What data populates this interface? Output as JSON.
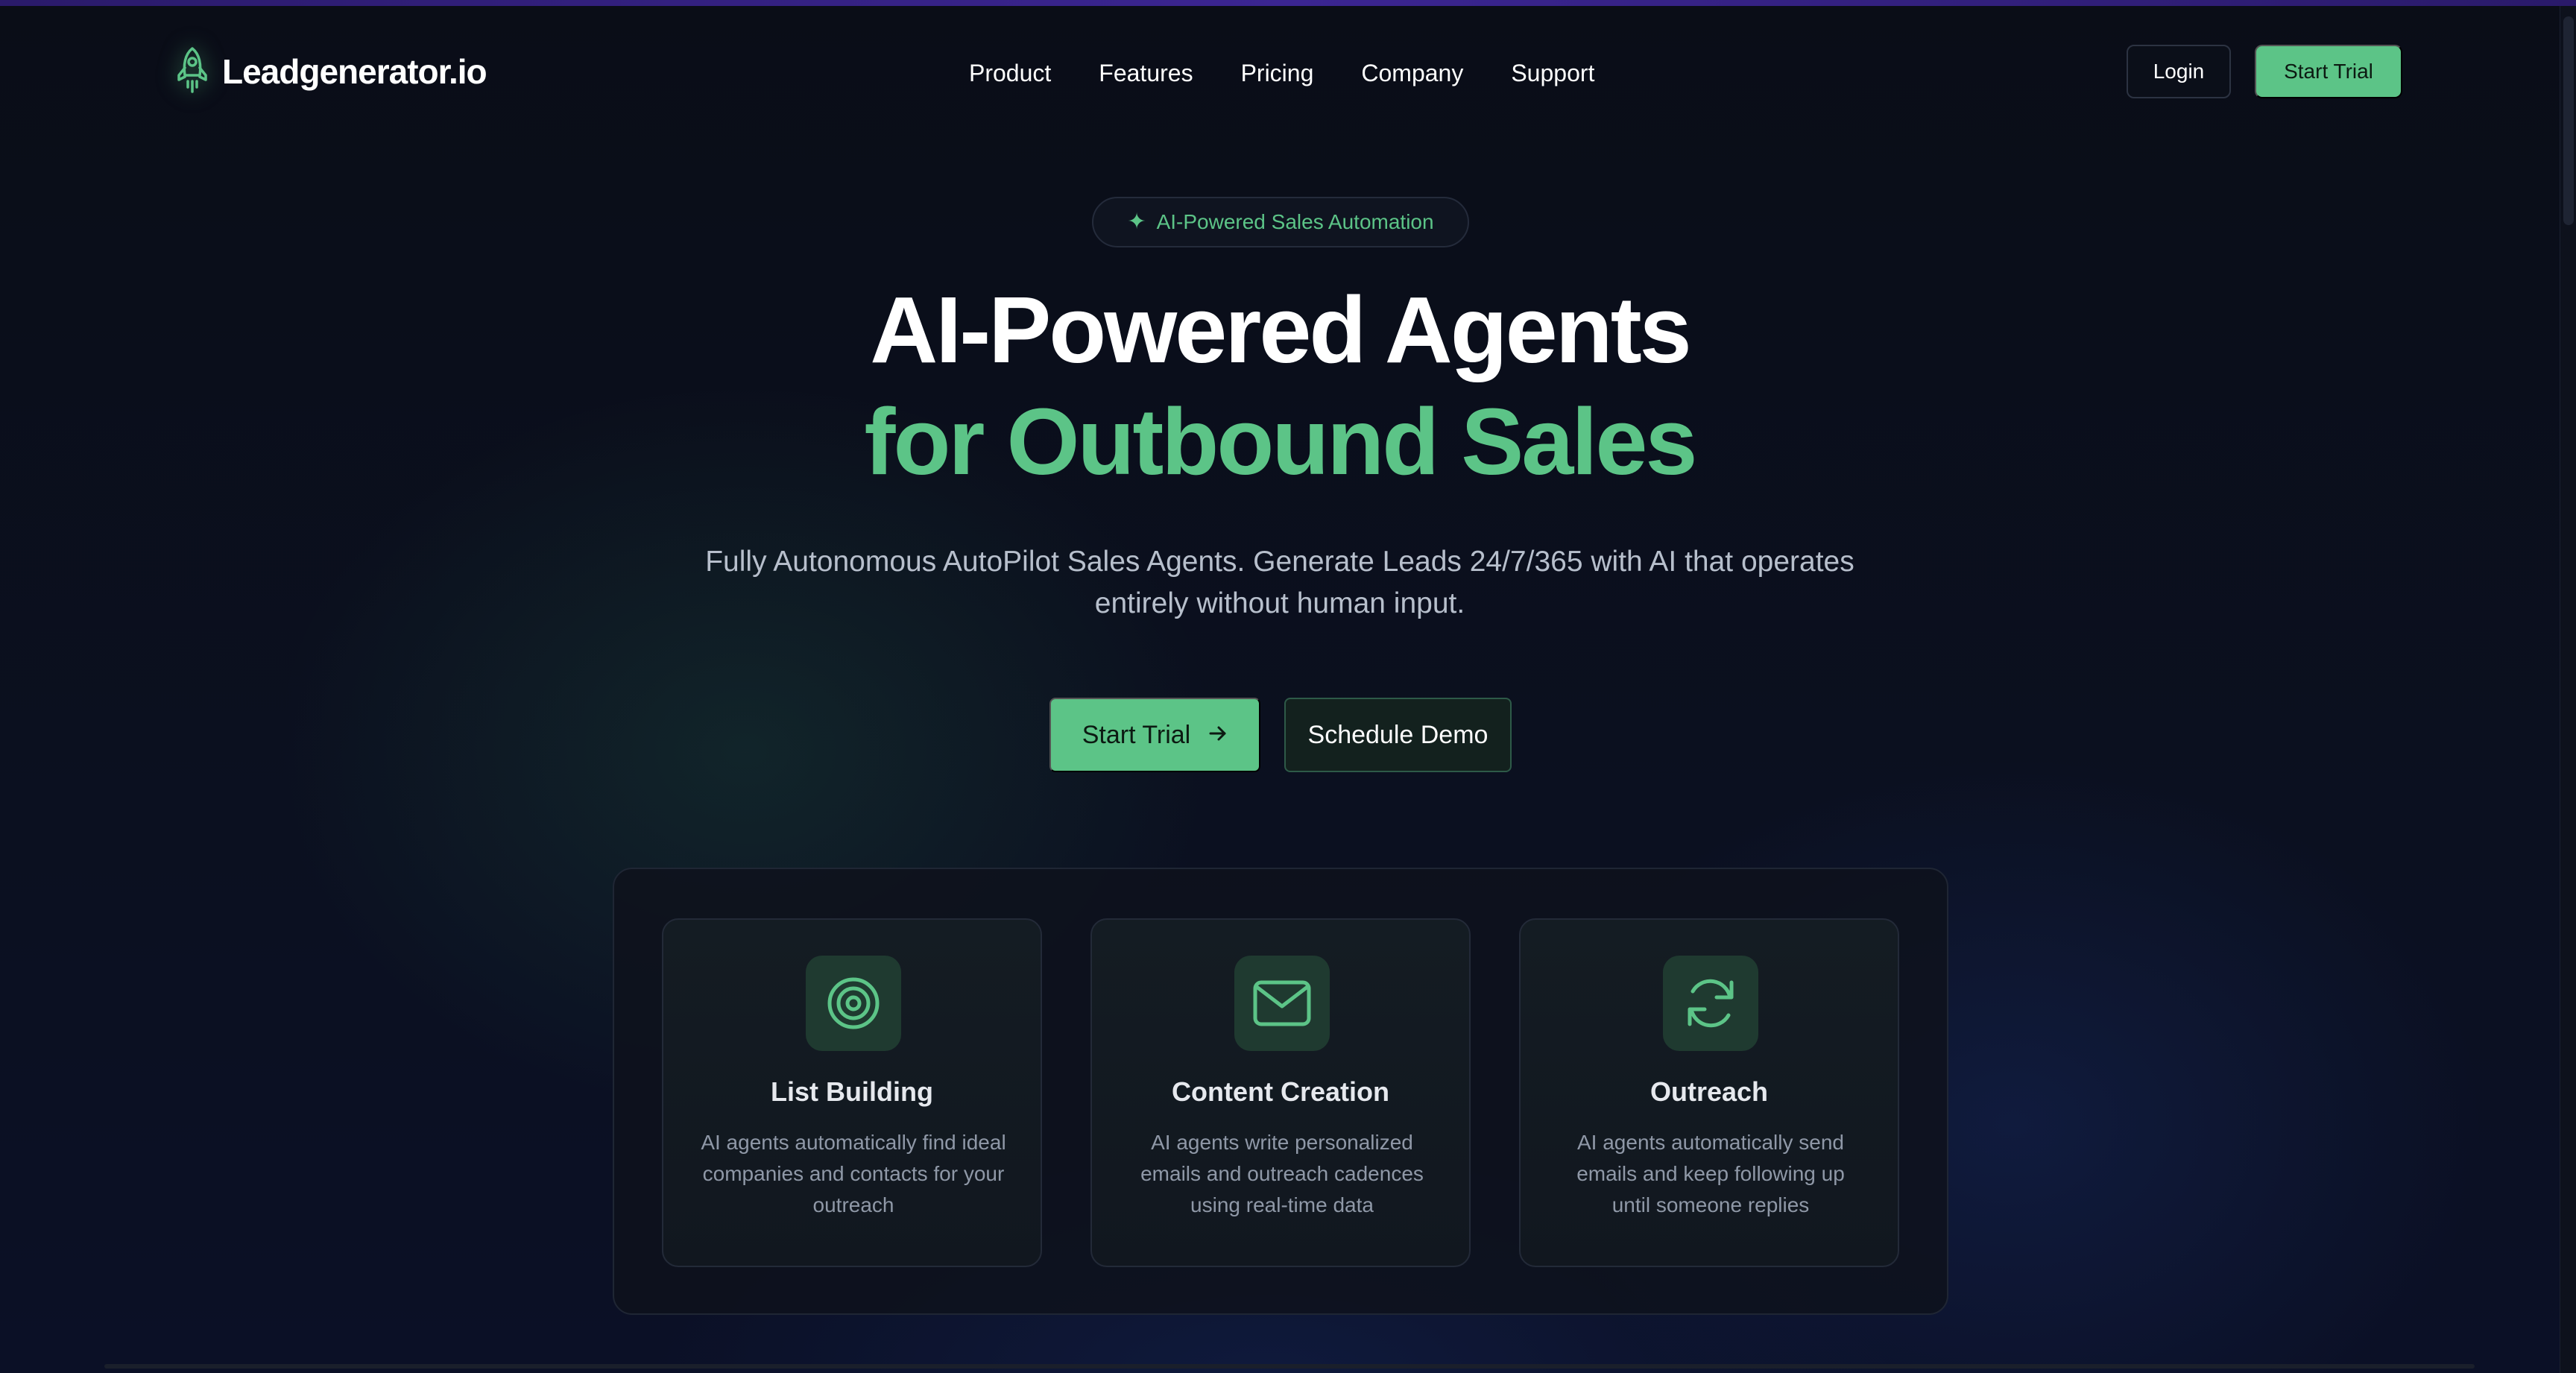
{
  "brand": {
    "name": "Leadgenerator.io",
    "icon": "rocket-icon"
  },
  "nav": {
    "links": [
      "Product",
      "Features",
      "Pricing",
      "Company",
      "Support"
    ],
    "login_label": "Login",
    "trial_label": "Start Trial"
  },
  "hero": {
    "badge_icon": "sparkle-icon",
    "badge_label": "AI-Powered Sales Automation",
    "title_line1": "AI-Powered Agents",
    "title_line2": "for Outbound Sales",
    "subtitle": "Fully Autonomous AutoPilot Sales Agents. Generate Leads 24/7/365 with AI that operates entirely without human input.",
    "cta_primary": "Start Trial",
    "cta_primary_icon": "arrow-right-icon",
    "cta_secondary": "Schedule Demo"
  },
  "features": [
    {
      "icon": "target-icon",
      "title": "List Building",
      "description": "AI agents automatically find ideal companies and contacts for your outreach"
    },
    {
      "icon": "mail-icon",
      "title": "Content Creation",
      "description": "AI agents write personalized emails and outreach cadences using real-time data"
    },
    {
      "icon": "refresh-icon",
      "title": "Outreach",
      "description": "AI agents automatically send emails and keep following up until someone replies"
    }
  ],
  "colors": {
    "accent": "#5cc487",
    "background": "#0b0f1a",
    "card_icon_bg": "#1f3a30"
  }
}
